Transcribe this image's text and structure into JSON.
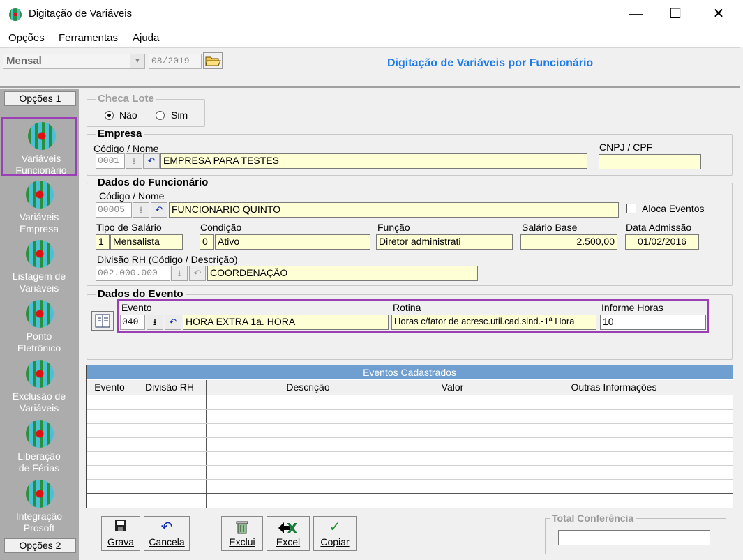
{
  "window": {
    "title": "Digitação de Variáveis",
    "minimize": "—",
    "maximize": "☐",
    "close": "✕"
  },
  "menu": [
    "Opções",
    "Ferramentas",
    "Ajuda"
  ],
  "toolbar": {
    "period": "Mensal",
    "date": "08/2019",
    "heading": "Digitação de Variáveis por Funcionário"
  },
  "sidebar": {
    "header_top": "Opções 1",
    "header_bottom": "Opções 2",
    "items": [
      {
        "label1": "Variáveis",
        "label2": "Funcionário"
      },
      {
        "label1": "Variáveis",
        "label2": "Empresa"
      },
      {
        "label1": "Listagem de",
        "label2": "Variáveis"
      },
      {
        "label1": "Ponto",
        "label2": "Eletrônico"
      },
      {
        "label1": "Exclusão de",
        "label2": "Variáveis"
      },
      {
        "label1": "Liberação",
        "label2": "de Férias"
      },
      {
        "label1": "Integração",
        "label2": "Prosoft"
      }
    ]
  },
  "checa_lote": {
    "legend": "Checa Lote",
    "nao": "Não",
    "sim": "Sim",
    "selected": "Não"
  },
  "empresa": {
    "legend": "Empresa",
    "code_label": "Código / Nome",
    "code": "0001",
    "name": "EMPRESA PARA TESTES",
    "cnpj_label": "CNPJ / CPF",
    "cnpj": ""
  },
  "funcionario": {
    "legend": "Dados do Funcionário",
    "code_label": "Código / Nome",
    "code": "00005",
    "name": "FUNCIONARIO QUINTO",
    "aloca_label": "Aloca Eventos",
    "tipo_label": "Tipo de Salário",
    "tipo_code": "1",
    "tipo_name": "Mensalista",
    "condicao_label": "Condição",
    "condicao_code": "0",
    "condicao_name": "Ativo",
    "funcao_label": "Função",
    "funcao": "Diretor administrati",
    "salario_label": "Salário Base",
    "salario": "2.500,00",
    "admissao_label": "Data Admissão",
    "admissao": "01/02/2016",
    "divisao_label": "Divisão RH (Código / Descrição)",
    "divisao_code": "002.000.000",
    "divisao_name": "COORDENAÇÃO"
  },
  "evento": {
    "legend": "Dados do Evento",
    "evento_label": "Evento",
    "code": "040",
    "name": "HORA EXTRA 1a. HORA",
    "rotina_label": "Rotina",
    "rotina": "Horas c/fator de acresc.util.cad.sind.-1ª Hora",
    "horas_label": "Informe Horas",
    "horas": "10"
  },
  "grid": {
    "caption": "Eventos Cadastrados",
    "columns": [
      "Evento",
      "Divisão RH",
      "Descrição",
      "Valor",
      "Outras Informações"
    ]
  },
  "buttons": {
    "grava": "Grava",
    "cancela": "Cancela",
    "exclui": "Exclui",
    "excel": "Excel",
    "copiar": "Copiar"
  },
  "total": {
    "legend": "Total Conferência",
    "value": ""
  }
}
